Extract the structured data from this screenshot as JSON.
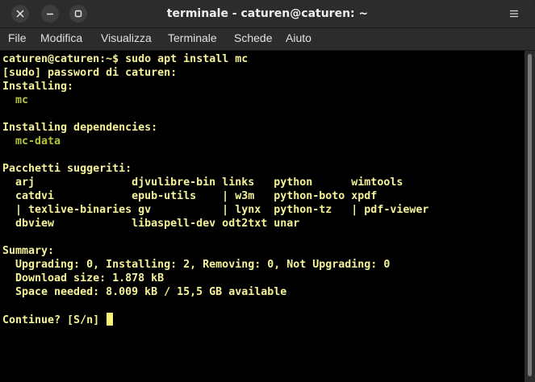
{
  "window": {
    "title": "terminale - caturen@caturen: ~"
  },
  "menubar": {
    "items": [
      "File",
      "Modifica",
      "Visualizza",
      "Terminale",
      "Schede",
      "Aiuto"
    ]
  },
  "colors": {
    "prompt_user": "#f5f58a",
    "text": "#f6f39a",
    "package": "#b5c23a",
    "background": "#000000"
  },
  "terminal": {
    "prompt_user": "caturen@caturen",
    "prompt_path": ":~$",
    "command": " sudo apt install mc",
    "lines": [
      "[sudo] password di caturen:",
      "Installing:",
      "  mc",
      "",
      "Installing dependencies:",
      "  mc-data",
      "",
      "Pacchetti suggeriti:",
      "  arj               djvulibre-bin links   python      wimtools",
      "  catdvi            epub-utils    | w3m   python-boto xpdf",
      "  | texlive-binaries gv           | lynx  python-tz   | pdf-viewer",
      "  dbview            libaspell-dev odt2txt unar",
      "",
      "Summary:",
      "  Upgrading: 0, Installing: 2, Removing: 0, Not Upgrading: 0",
      "  Download size: 1.878 kB",
      "  Space needed: 8.009 kB / 15,5 GB available",
      "",
      "Continue? [S/n] "
    ]
  }
}
